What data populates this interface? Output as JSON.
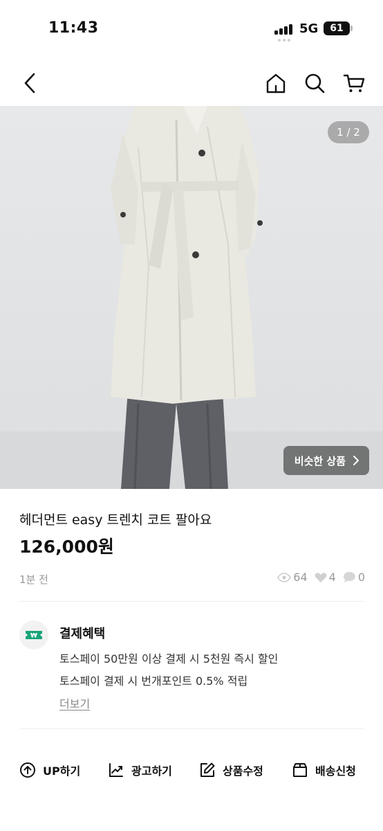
{
  "status": {
    "time": "11:43",
    "network": "5G",
    "battery": "61"
  },
  "nav": {},
  "hero": {
    "counter": "1 / 2",
    "similar_label": "비슷한 상품"
  },
  "product": {
    "title": "헤더먼트 easy 트렌치 코트 팔아요",
    "price": "126,000원",
    "posted": "1분 전",
    "views": "64",
    "likes": "4",
    "chats": "0"
  },
  "benefit": {
    "title": "결제혜택",
    "lines": [
      "토스페이 50만원 이상 결제 시 5천원 즉시 할인",
      "토스페이 결제 시 번개포인트 0.5% 적립"
    ],
    "more": "더보기",
    "icon_color": "#1aa37a"
  },
  "actions": [
    {
      "label": "UP하기",
      "icon": "arrow-up-circle-icon"
    },
    {
      "label": "광고하기",
      "icon": "chart-up-icon"
    },
    {
      "label": "상품수정",
      "icon": "edit-icon"
    },
    {
      "label": "배송신청",
      "icon": "box-icon"
    }
  ]
}
